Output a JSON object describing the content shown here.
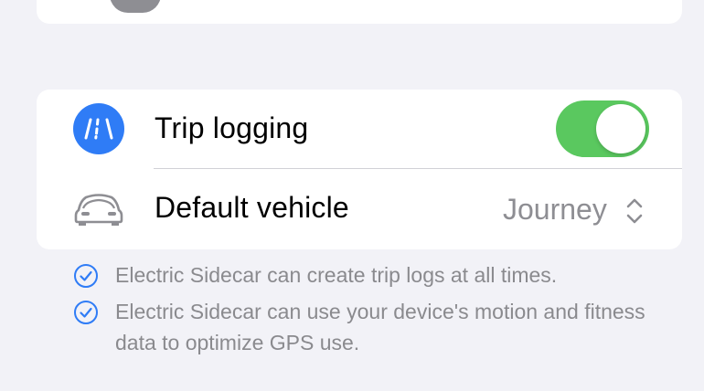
{
  "settings": {
    "trip_logging": {
      "label": "Trip logging",
      "icon": "road-icon",
      "enabled": true,
      "accent": "#2f7cf6",
      "toggle_on_color": "#5ac85f"
    },
    "default_vehicle": {
      "label": "Default vehicle",
      "icon": "car-icon",
      "value": "Journey"
    }
  },
  "notes": [
    {
      "icon": "checkmark-circle-icon",
      "text": "Electric Sidecar can create trip logs at all times."
    },
    {
      "icon": "checkmark-circle-icon",
      "text": "Electric Sidecar can use your device's motion and fitness data to optimize GPS use."
    }
  ]
}
